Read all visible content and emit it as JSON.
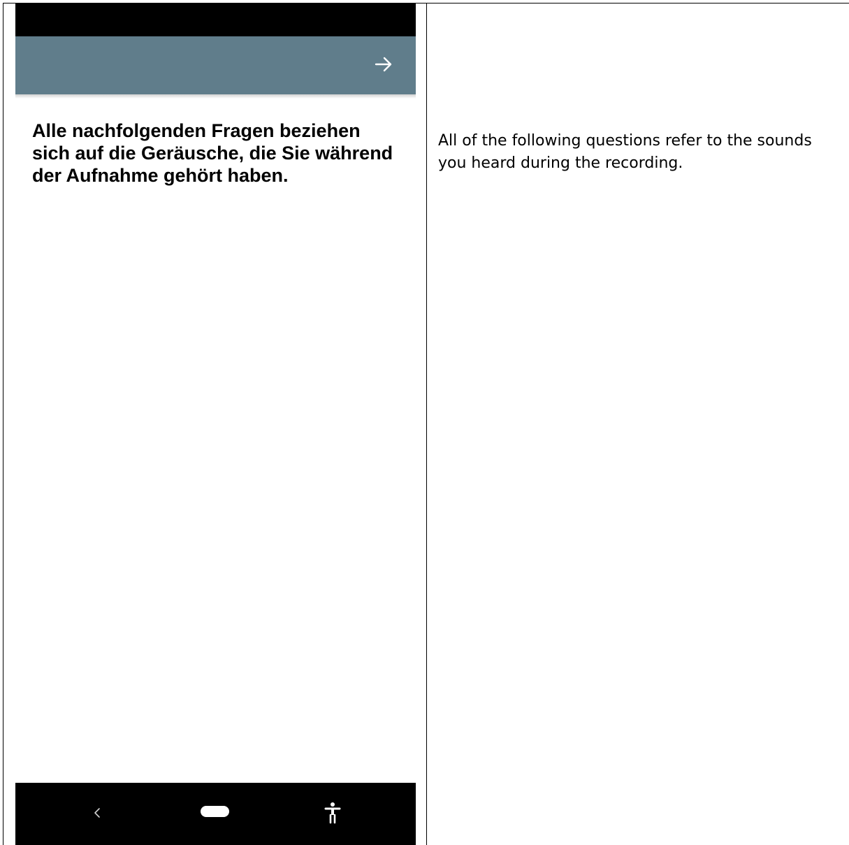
{
  "phone": {
    "app_bar": {
      "color": "#607d8b",
      "next_icon": "arrow-right-icon"
    },
    "question_text": "Alle nachfolgenden Fragen beziehen sich auf die Geräusche, die Sie während der Aufnahme gehört haben.",
    "navigation_bar": {
      "back_icon": "chevron-left-icon",
      "home_icon": "home-pill-icon",
      "accessibility_icon": "accessibility-icon"
    }
  },
  "translation": {
    "text": "All of the following questions refer to the sounds you heard during the recording."
  }
}
